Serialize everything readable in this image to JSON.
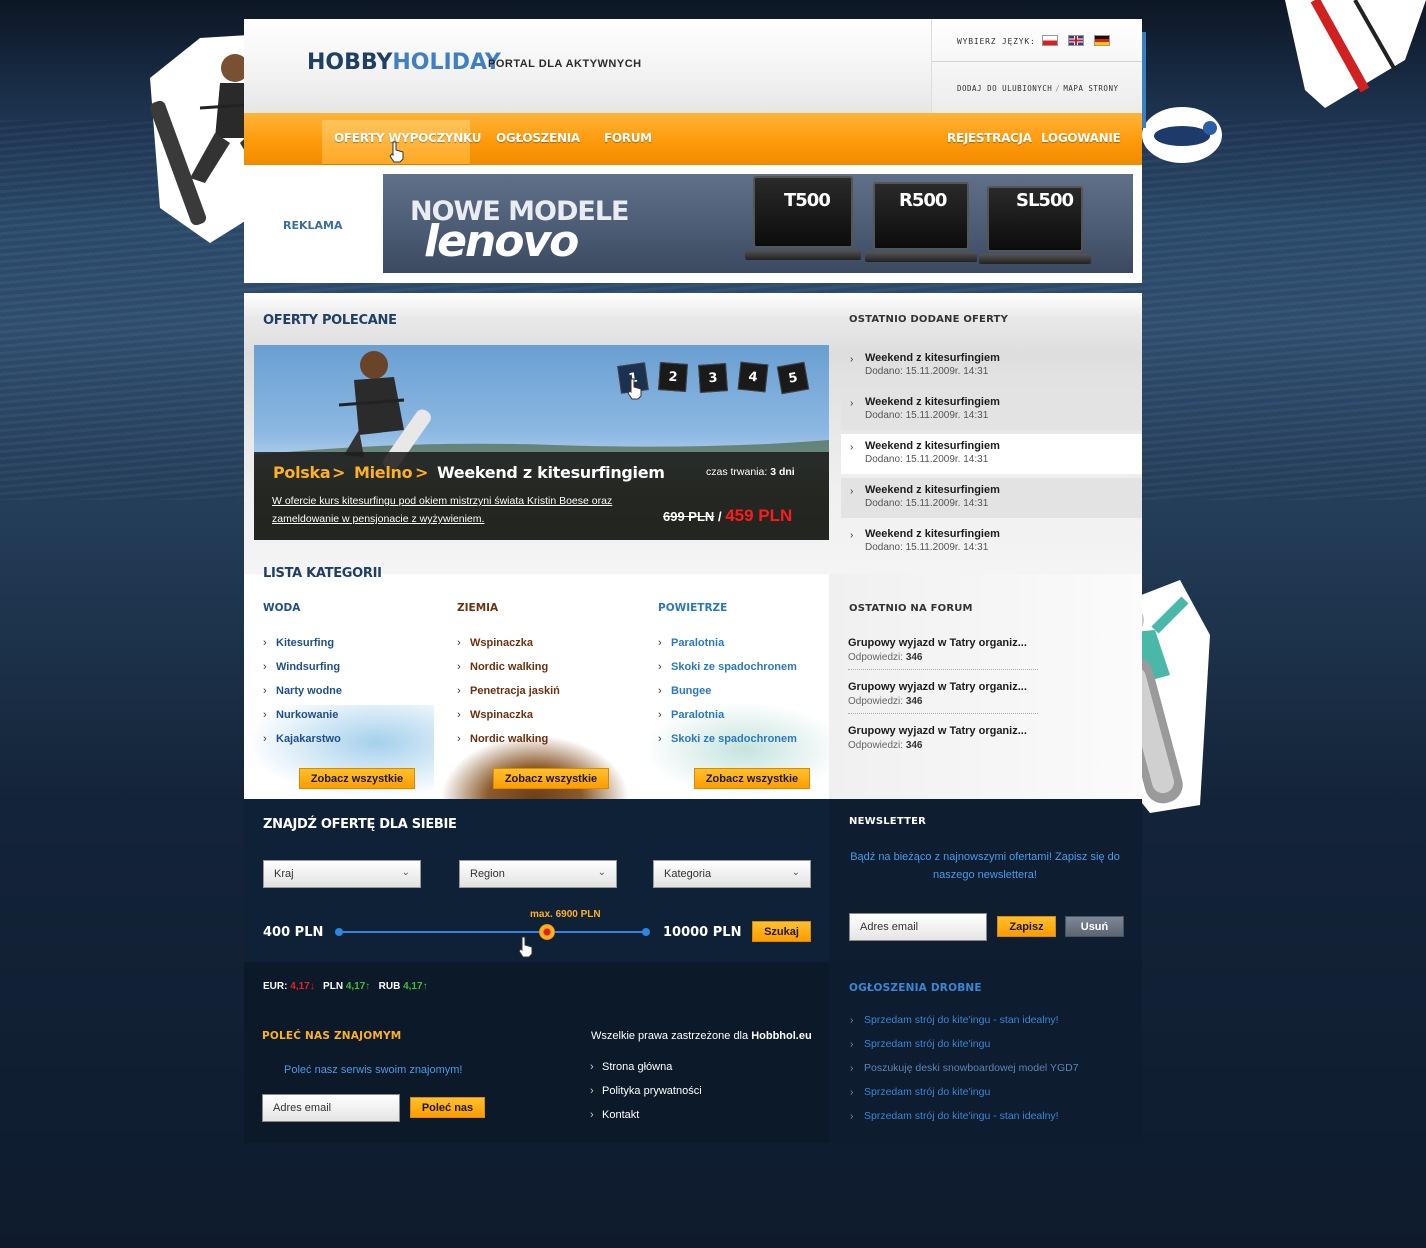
{
  "brand": {
    "logo_part1": "HOBBY",
    "logo_part2": "HOLIDAY",
    "tagline": "PORTAL DLA AKTYWNYCH"
  },
  "header": {
    "lang_label": "WYBIERZ JĘZYK:",
    "languages": [
      "pl",
      "en",
      "de"
    ],
    "fav_link": "DODAJ DO ULUBIONYCH",
    "sitemap_link": "MAPA STRONY"
  },
  "nav": {
    "items": [
      "OFERTY WYPOCZYNKU",
      "OGŁOSZENIA",
      "FORUM"
    ],
    "active": "OFERTY WYPOCZYNKU",
    "register": "REJESTRACJA",
    "login": "LOGOWANIE"
  },
  "ad": {
    "label": "REKLAMA",
    "line1": "NOWE MODELE",
    "line2": "lenovo",
    "models": [
      "T500",
      "R500",
      "SL500"
    ]
  },
  "featured": {
    "title": "OFERTY POLECANE",
    "pages": [
      "1",
      "2",
      "3",
      "4",
      "5"
    ],
    "active_page": "1",
    "crumb": [
      "Polska",
      "Mielno",
      "Weekend z kitesurfingiem"
    ],
    "crumb_sep": ">",
    "description": "W ofercie kurs kitesurfingu pod okiem mistrzyni świata Kristin Boese oraz zameldowanie w pensjonacie z wyżywieniem.",
    "duration_label": "czas trwania:",
    "duration_value": "3 dni",
    "old_price": "699 PLN",
    "price_sep": "/",
    "new_price": "459 PLN"
  },
  "recent": {
    "title": "OSTATNIO DODANE OFERTY",
    "items": [
      {
        "title": "Weekend z kitesurfingiem",
        "date": "Dodano: 15.11.2009r. 14:31"
      },
      {
        "title": "Weekend z kitesurfingiem",
        "date": "Dodano: 15.11.2009r. 14:31"
      },
      {
        "title": "Weekend z kitesurfingiem",
        "date": "Dodano: 15.11.2009r. 14:31"
      },
      {
        "title": "Weekend z kitesurfingiem",
        "date": "Dodano: 15.11.2009r. 14:31"
      },
      {
        "title": "Weekend z kitesurfingiem",
        "date": "Dodano: 15.11.2009r. 14:31"
      }
    ]
  },
  "categories": {
    "title": "LISTA KATEGORII",
    "see_all": "Zobacz wszystkie",
    "groups": [
      {
        "name": "WODA",
        "color": "#1f4f8a",
        "items": [
          "Kitesurfing",
          "Windsurfing",
          "Narty wodne",
          "Nurkowanie",
          "Kajakarstwo"
        ]
      },
      {
        "name": "ZIEMIA",
        "color": "#6b3210",
        "items": [
          "Wspinaczka",
          "Nordic walking",
          "Penetracja jaskiń",
          "Wspinaczka",
          "Nordic walking"
        ]
      },
      {
        "name": "POWIETRZE",
        "color": "#2b78c2",
        "items": [
          "Paralotnia",
          "Skoki ze spadochronem",
          "Bungee",
          "Paralotnia",
          "Skoki ze spadochronem"
        ]
      }
    ]
  },
  "forum": {
    "title": "OSTATNIO NA FORUM",
    "items": [
      {
        "title": "Grupowy wyjazd w Tatry organiz...",
        "label": "Odpowiedzi:",
        "count": "346"
      },
      {
        "title": "Grupowy wyjazd w Tatry organiz...",
        "label": "Odpowiedzi:",
        "count": "346"
      },
      {
        "title": "Grupowy wyjazd w Tatry organiz...",
        "label": "Odpowiedzi:",
        "count": "346"
      }
    ]
  },
  "search": {
    "title": "ZNAJDŹ OFERTĘ DLA SIEBIE",
    "selects": [
      "Kraj",
      "Region",
      "Kategoria"
    ],
    "min_label": "400 PLN",
    "max_label": "10000 PLN",
    "current_label": "max. 6900 PLN",
    "min": 400,
    "max": 10000,
    "value": 6900,
    "button": "Szukaj"
  },
  "newsletter": {
    "title": "NEWSLETTER",
    "text": "Bądź na bieżąco z najnowszymi ofertami! Zapisz się do naszego newslettera!",
    "placeholder": "Adres email",
    "subscribe": "Zapisz",
    "unsubscribe": "Usuń"
  },
  "currency": [
    {
      "code": "EUR:",
      "value": "4,17",
      "dir": "↓",
      "color": "#e82020"
    },
    {
      "code": "PLN",
      "value": "4,17",
      "dir": "↑",
      "color": "#38c038"
    },
    {
      "code": "RUB",
      "value": "4,17",
      "dir": "↑",
      "color": "#38c038"
    }
  ],
  "recommend": {
    "title": "POLEĆ NAS ZNAJOMYM",
    "text": "Poleć nasz serwis swoim znajomym!",
    "placeholder": "Adres email",
    "button": "Poleć nas"
  },
  "footer": {
    "copyright_prefix": "Wszelkie prawa zastrzeżone dla ",
    "copyright_site": "Hobbhol.eu",
    "links": [
      "Strona główna",
      "Polityka prywatności",
      "Kontakt"
    ]
  },
  "classifieds": {
    "title": "OGŁOSZENIA DROBNE",
    "items": [
      "Sprzedam strój do kite'ingu - stan idealny!",
      "Sprzedam strój do kite'ingu",
      "Poszukuję deski snowboardowej model YGD7",
      "Sprzedam strój do kite'ingu",
      "Sprzedam strój do kite'ingu - stan idealny!"
    ]
  },
  "colors": {
    "accent": "#ff9a0a",
    "brand_dark": "#1f3f63",
    "brand_light": "#3f7fc2",
    "price": "#ff1a1a",
    "link_blue": "#3a86d6"
  }
}
